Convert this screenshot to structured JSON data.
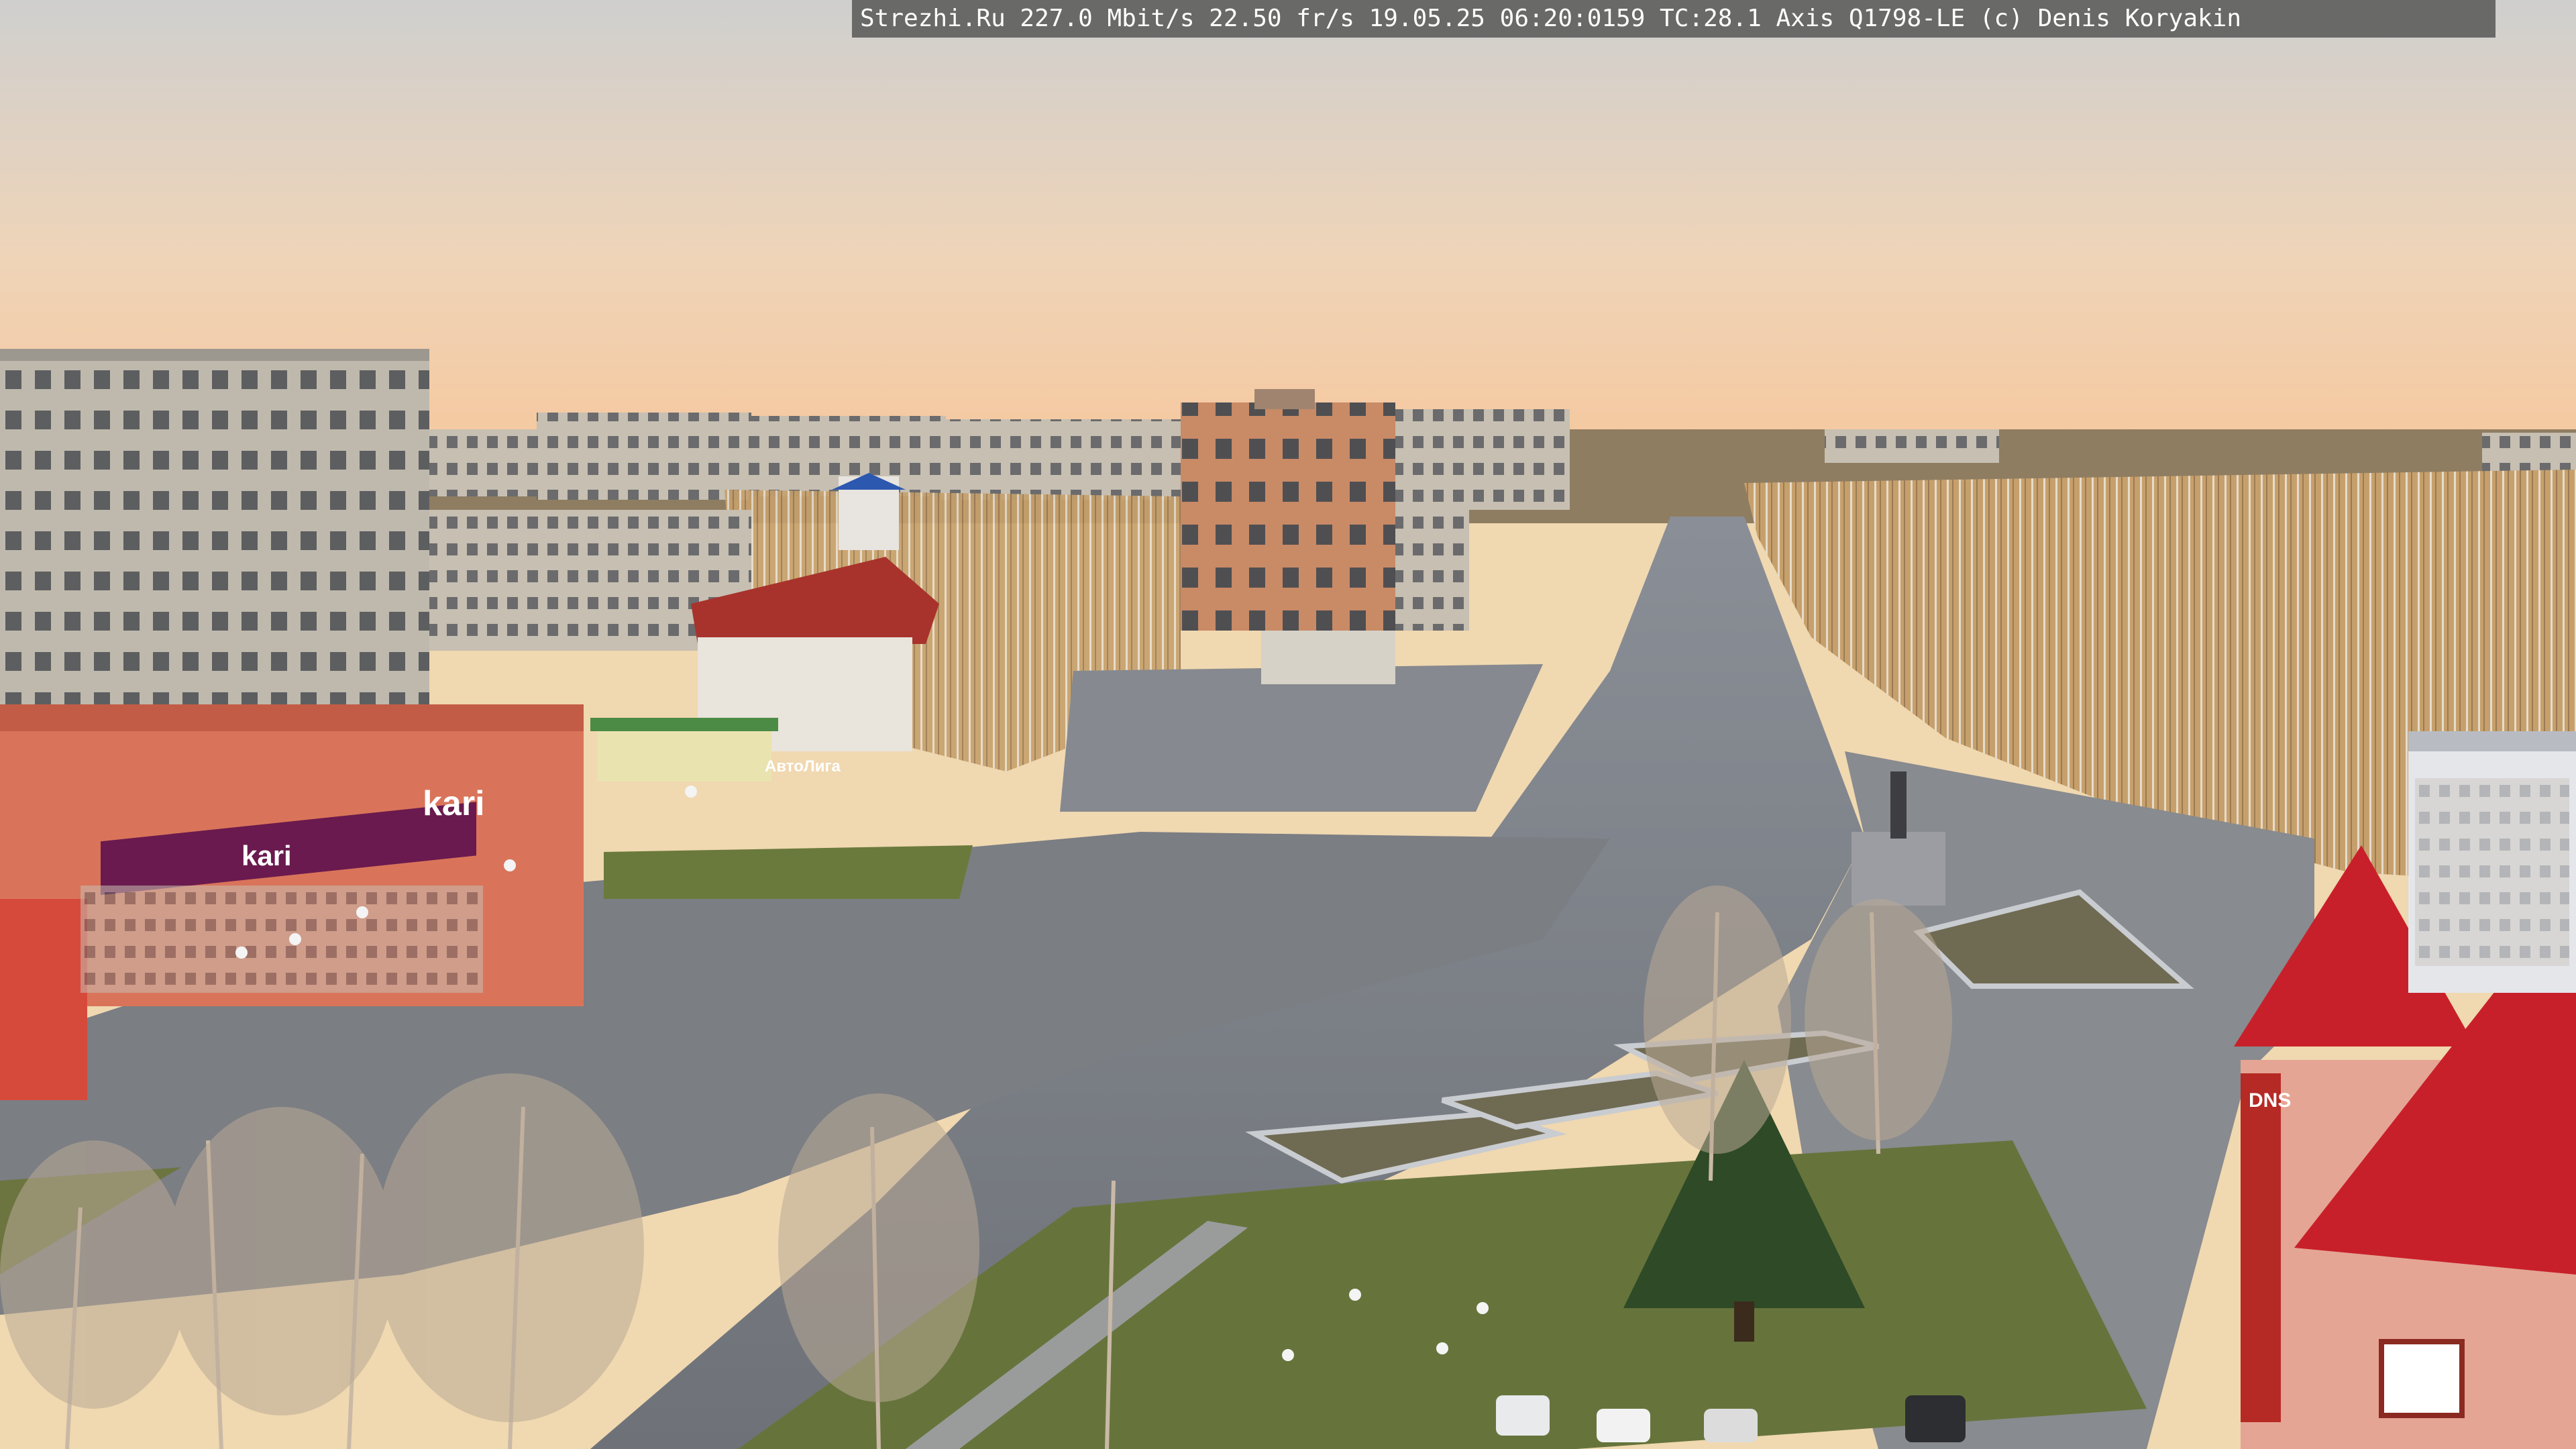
{
  "overlay": {
    "text": "Strezhi.Ru 227.0 Mbit/s 22.50 fr/s 19.05.25 06:20:0159 TC:28.1  Axis Q1798-LE  (c) Denis Koryakin"
  },
  "signs": {
    "store_kari_large": "kari",
    "store_kari_small": "kari",
    "store_dns": "DNS",
    "shop_autoliga": "АвтоЛига"
  },
  "colors": {
    "sky_top": "#d6d4d2",
    "sky_horizon": "#f4c9a0",
    "asphalt": "#7d8086",
    "trees": "#c9a472",
    "roof_red": "#c8202a",
    "kari_purple": "#6a1a4e"
  }
}
